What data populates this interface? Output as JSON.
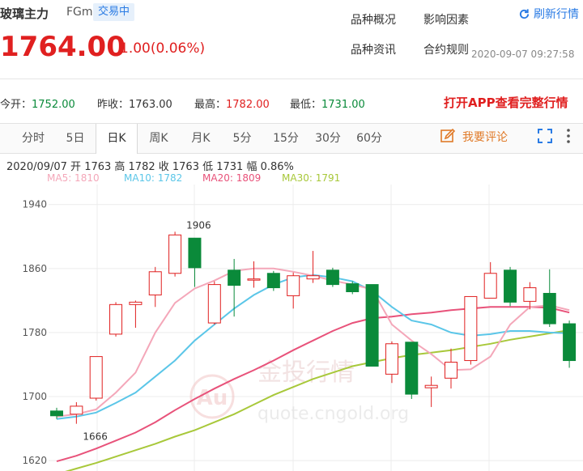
{
  "header": {
    "title": "玻璃主力",
    "code": "FGm",
    "status": "交易中",
    "links": [
      "品种概况",
      "影响因素",
      "品种资讯",
      "合约规则"
    ],
    "refresh_label": "刷新行情"
  },
  "quote": {
    "price": "1764.00",
    "change": "1.00(0.06%)",
    "datetime": "2020-09-07 09:27:58",
    "open_label": "今开：",
    "open": "1752.00",
    "prev_close_label": "昨收：",
    "prev_close": "1763.00",
    "high_label": "最高：",
    "high": "1782.00",
    "low_label": "最低：",
    "low": "1731.00",
    "app_promo": "打开APP查看完整行情"
  },
  "tabs": [
    "分时",
    "5日",
    "日K",
    "周K",
    "月K",
    "5分",
    "15分",
    "30分",
    "60分"
  ],
  "active_tab": "日K",
  "toolbar": {
    "comment_label": "我要评论"
  },
  "colors": {
    "up": "#e02020",
    "down": "#0a8a3a",
    "accent": "#2a7be4",
    "ma5": "#f4a7b9",
    "ma10": "#5bc6e8",
    "ma20": "#e8527a",
    "ma30": "#a8c83a"
  },
  "chart_data": {
    "type": "candlestick",
    "info_line": "2020/09/07  开 1763  高 1782  收 1763  低 1731  幅 0.86%",
    "ma_labels": [
      "MA5: 1810",
      "MA10: 1782",
      "MA20: 1809",
      "MA30: 1791"
    ],
    "y_ticks": [
      1940,
      1860,
      1780,
      1700,
      1620
    ],
    "ylim": [
      1607,
      1965
    ],
    "annotations": {
      "high": "1906",
      "low": "1666"
    },
    "watermark": {
      "brand": "金投行情",
      "url": "quote.cngold.org"
    },
    "candles": [
      {
        "o": 1682,
        "c": 1676,
        "h": 1686,
        "l": 1672
      },
      {
        "o": 1678,
        "c": 1688,
        "h": 1693,
        "l": 1666
      },
      {
        "o": 1698,
        "c": 1750,
        "h": 1750,
        "l": 1695
      },
      {
        "o": 1778,
        "c": 1815,
        "h": 1818,
        "l": 1775
      },
      {
        "o": 1815,
        "c": 1818,
        "h": 1820,
        "l": 1786
      },
      {
        "o": 1827,
        "c": 1856,
        "h": 1862,
        "l": 1812
      },
      {
        "o": 1854,
        "c": 1902,
        "h": 1906,
        "l": 1850
      },
      {
        "o": 1898,
        "c": 1861,
        "h": 1898,
        "l": 1837
      },
      {
        "o": 1792,
        "c": 1840,
        "h": 1844,
        "l": 1790
      },
      {
        "o": 1858,
        "c": 1839,
        "h": 1872,
        "l": 1800
      },
      {
        "o": 1847,
        "c": 1847,
        "h": 1869,
        "l": 1836
      },
      {
        "o": 1854,
        "c": 1836,
        "h": 1857,
        "l": 1832
      },
      {
        "o": 1826,
        "c": 1851,
        "h": 1855,
        "l": 1810
      },
      {
        "o": 1847,
        "c": 1851,
        "h": 1882,
        "l": 1842
      },
      {
        "o": 1858,
        "c": 1840,
        "h": 1861,
        "l": 1837
      },
      {
        "o": 1841,
        "c": 1831,
        "h": 1844,
        "l": 1828
      },
      {
        "o": 1840,
        "c": 1738,
        "h": 1840,
        "l": 1738
      },
      {
        "o": 1728,
        "c": 1766,
        "h": 1769,
        "l": 1717
      },
      {
        "o": 1768,
        "c": 1703,
        "h": 1768,
        "l": 1697
      },
      {
        "o": 1711,
        "c": 1714,
        "h": 1725,
        "l": 1687
      },
      {
        "o": 1723,
        "c": 1743,
        "h": 1760,
        "l": 1710
      },
      {
        "o": 1745,
        "c": 1825,
        "h": 1825,
        "l": 1740
      },
      {
        "o": 1823,
        "c": 1854,
        "h": 1868,
        "l": 1823
      },
      {
        "o": 1858,
        "c": 1818,
        "h": 1862,
        "l": 1813
      },
      {
        "o": 1819,
        "c": 1836,
        "h": 1843,
        "l": 1809
      },
      {
        "o": 1829,
        "c": 1791,
        "h": 1859,
        "l": 1787
      },
      {
        "o": 1791,
        "c": 1745,
        "h": 1795,
        "l": 1736
      }
    ],
    "ma5": [
      1675,
      1678,
      1684,
      1705,
      1730,
      1780,
      1817,
      1835,
      1845,
      1857,
      1860,
      1860,
      1856,
      1851,
      1845,
      1840,
      1834,
      1790,
      1770,
      1753,
      1733,
      1734,
      1750,
      1790,
      1812,
      1814,
      1808
    ],
    "ma10": [
      1672,
      1675,
      1680,
      1692,
      1705,
      1725,
      1745,
      1770,
      1790,
      1810,
      1827,
      1840,
      1849,
      1852,
      1849,
      1844,
      1832,
      1812,
      1795,
      1790,
      1780,
      1776,
      1778,
      1782,
      1782,
      1780,
      1779
    ],
    "ma20": [
      1619,
      1626,
      1635,
      1645,
      1655,
      1668,
      1683,
      1697,
      1710,
      1722,
      1733,
      1745,
      1758,
      1770,
      1782,
      1792,
      1798,
      1800,
      1803,
      1805,
      1808,
      1810,
      1812,
      1812,
      1812,
      1811,
      1805
    ],
    "ma30": [
      1603,
      1610,
      1617,
      1625,
      1633,
      1641,
      1650,
      1658,
      1668,
      1678,
      1690,
      1702,
      1712,
      1722,
      1730,
      1738,
      1743,
      1748,
      1752,
      1755,
      1758,
      1762,
      1766,
      1771,
      1775,
      1779,
      1783
    ]
  }
}
